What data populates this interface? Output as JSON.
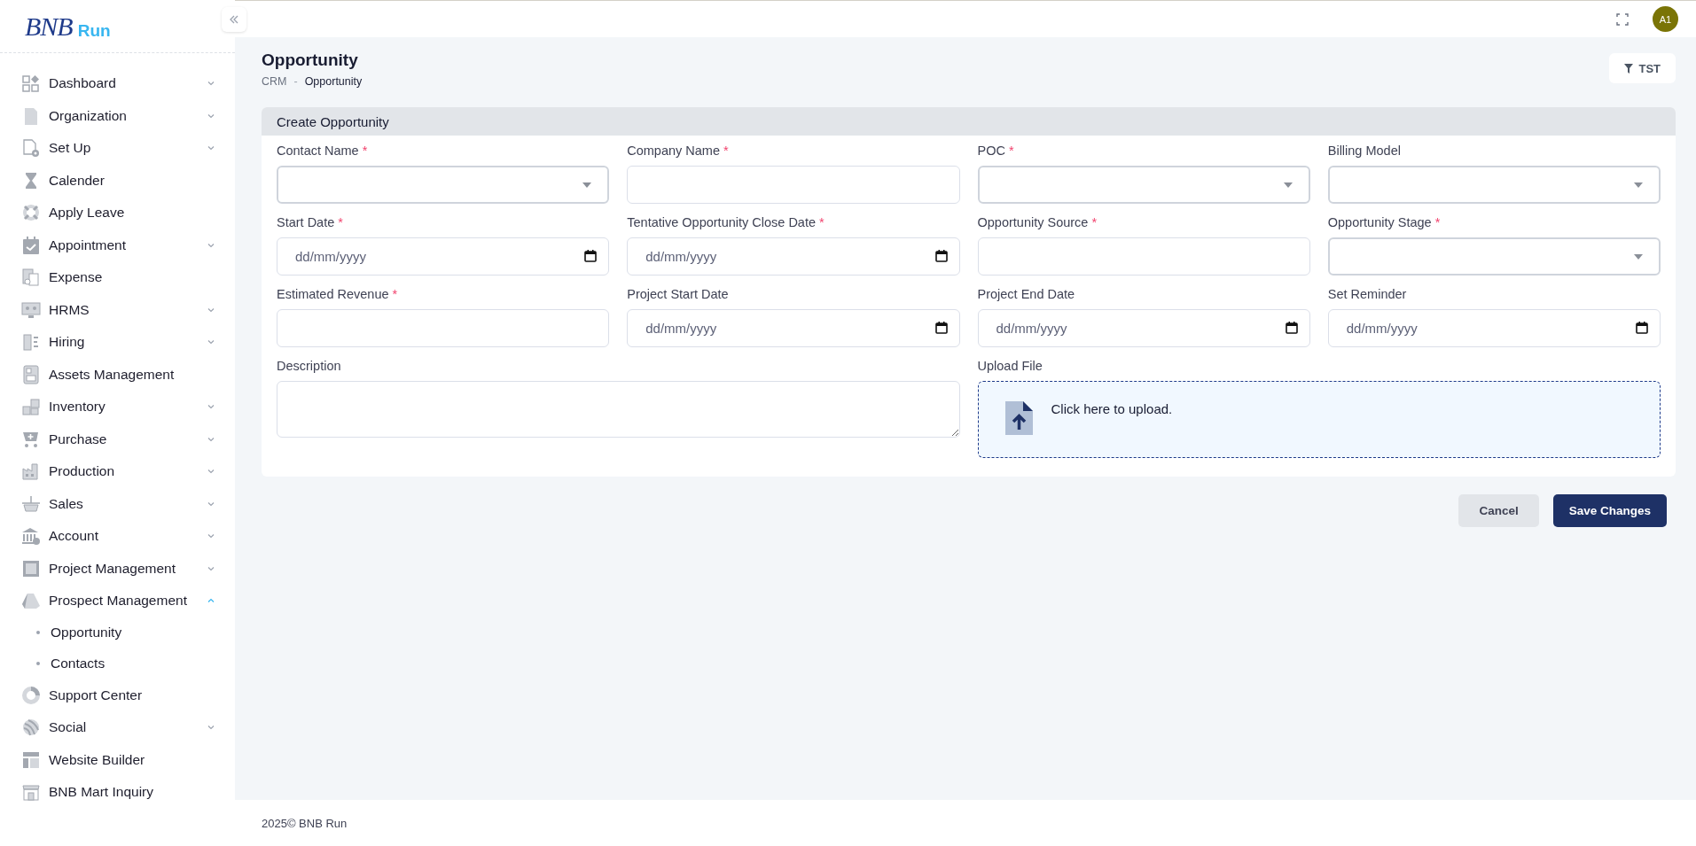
{
  "logo": {
    "mark": "BNB",
    "name": "Run"
  },
  "sidebar": {
    "items": [
      {
        "label": "Dashboard",
        "expanded": false
      },
      {
        "label": "Organization",
        "expanded": false
      },
      {
        "label": "Set Up",
        "expanded": false
      },
      {
        "label": "Calender"
      },
      {
        "label": "Apply Leave"
      },
      {
        "label": "Appointment",
        "expanded": false
      },
      {
        "label": "Expense"
      },
      {
        "label": "HRMS",
        "expanded": false
      },
      {
        "label": "Hiring",
        "expanded": false
      },
      {
        "label": "Assets Management"
      },
      {
        "label": "Inventory",
        "expanded": false
      },
      {
        "label": "Purchase",
        "expanded": false
      },
      {
        "label": "Production",
        "expanded": false
      },
      {
        "label": "Sales",
        "expanded": false
      },
      {
        "label": "Account",
        "expanded": false
      },
      {
        "label": "Project Management",
        "expanded": false
      },
      {
        "label": "Prospect Management",
        "expanded": true,
        "children": [
          {
            "label": "Opportunity"
          },
          {
            "label": "Contacts"
          }
        ]
      },
      {
        "label": "Support Center"
      },
      {
        "label": "Social",
        "expanded": false
      },
      {
        "label": "Website Builder"
      },
      {
        "label": "BNB Mart Inquiry"
      }
    ]
  },
  "header": {
    "avatar": "A1"
  },
  "page": {
    "title": "Opportunity",
    "breadcrumb": {
      "items": [
        "CRM",
        "Opportunity"
      ],
      "separator": "-"
    },
    "filter_button": "TST"
  },
  "form": {
    "title": "Create Opportunity",
    "fields": [
      {
        "kind": "select",
        "label": "Contact Name",
        "required": true
      },
      {
        "kind": "text",
        "label": "Company Name",
        "required": true
      },
      {
        "kind": "select",
        "label": "POC",
        "required": true
      },
      {
        "kind": "select",
        "label": "Billing Model",
        "required": false
      },
      {
        "kind": "date",
        "label": "Start Date",
        "required": true,
        "placeholder": "dd/mm/yyyy"
      },
      {
        "kind": "date",
        "label": "Tentative Opportunity Close Date",
        "required": true,
        "placeholder": "dd/mm/yyyy"
      },
      {
        "kind": "text",
        "label": "Opportunity Source",
        "required": true
      },
      {
        "kind": "select",
        "label": "Opportunity Stage",
        "required": true
      },
      {
        "kind": "text",
        "label": "Estimated Revenue",
        "required": true
      },
      {
        "kind": "date",
        "label": "Project Start Date",
        "required": false,
        "placeholder": "dd/mm/yyyy"
      },
      {
        "kind": "date",
        "label": "Project End Date",
        "required": false,
        "placeholder": "dd/mm/yyyy"
      },
      {
        "kind": "date",
        "label": "Set Reminder",
        "required": false,
        "placeholder": "dd/mm/yyyy"
      },
      {
        "kind": "textarea",
        "label": "Description",
        "required": false
      },
      {
        "kind": "upload",
        "label": "Upload File",
        "required": false,
        "prompt": "Click here to upload."
      }
    ],
    "required_mark": "*",
    "buttons": [
      {
        "kind": "secondary",
        "label": "Cancel"
      },
      {
        "kind": "primary",
        "label": "Save Changes"
      }
    ]
  },
  "footer": "2025© BNB Run"
}
